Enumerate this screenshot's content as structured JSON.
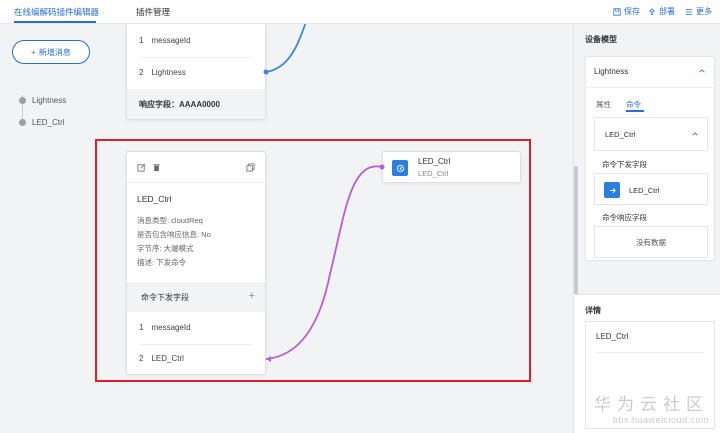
{
  "header": {
    "tabs": [
      {
        "label": "在线编解码插件编辑器",
        "active": true
      },
      {
        "label": "插件管理",
        "active": false
      }
    ],
    "actions": [
      {
        "label": "保存",
        "icon": "save-icon"
      },
      {
        "label": "部署",
        "icon": "deploy-icon"
      },
      {
        "label": "更多",
        "icon": "more-icon"
      }
    ]
  },
  "canvas": {
    "add_message_label": "新增消息",
    "tree_items": [
      "Lightness",
      "LED_Ctrl"
    ],
    "top_card": {
      "fields": [
        {
          "index": "1",
          "name": "messageId"
        },
        {
          "index": "2",
          "name": "Lightness"
        }
      ],
      "response_field": "响应字段：AAAA0000"
    },
    "message_card": {
      "title": "LED_Ctrl",
      "meta": [
        "消息类型: cloudReq",
        "是否包含响应信息: No",
        "字节序: 大端模式",
        "描述: 下发命令"
      ],
      "section_label": "命令下发字段",
      "fields": [
        {
          "index": "1",
          "name": "messageId"
        },
        {
          "index": "2",
          "name": "LED_Ctrl"
        }
      ]
    },
    "command_card": {
      "name": "LED_Ctrl",
      "subtitle": "LED_Ctrl"
    }
  },
  "right_panel": {
    "title": "设备模型",
    "model_name": "Lightness",
    "tabs": [
      {
        "label": "属性",
        "active": false
      },
      {
        "label": "命令",
        "active": true
      }
    ],
    "command_name": "LED_Ctrl",
    "send_fields_label": "命令下发字段",
    "send_field_item": "LED_Ctrl",
    "response_fields_label": "命令响应字段",
    "empty_text": "没有数据"
  },
  "details": {
    "title": "详情",
    "value": "LED_Ctrl"
  },
  "watermark": {
    "cn": "华为云社区",
    "en": "bbs.huaweicloud.com"
  },
  "colors": {
    "accent": "#2b6cd9",
    "highlight_frame": "#e11d2a",
    "wire_blue": "#3f88d6",
    "wire_purple": "#b45fd1"
  }
}
